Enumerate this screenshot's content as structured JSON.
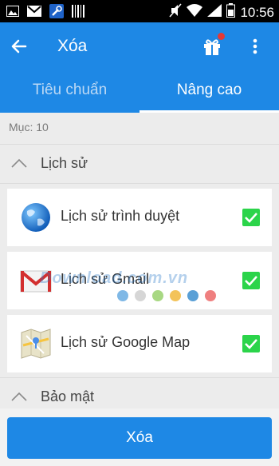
{
  "status_bar": {
    "time": "10:56",
    "icons": [
      "image-icon",
      "gmail-icon",
      "wrench-icon",
      "barcode-icon",
      "mute-icon",
      "wifi-icon",
      "signal-icon",
      "battery-icon"
    ]
  },
  "app_bar": {
    "title": "Xóa",
    "icons": [
      "back-arrow-icon",
      "gift-icon",
      "more-vert-icon"
    ],
    "accent_color": "#1e88e5",
    "badge_color": "#e53935"
  },
  "tabs": [
    {
      "label": "Tiêu chuẩn",
      "active": false
    },
    {
      "label": "Nâng cao",
      "active": true
    }
  ],
  "item_count": "Mục: 10",
  "sections": [
    {
      "title": "Lịch sử",
      "expanded": true,
      "items": [
        {
          "label": "Lịch sử trình duyệt",
          "icon": "globe-icon",
          "checked": true
        },
        {
          "label": "Lịch sử Gmail",
          "icon": "gmail-icon",
          "checked": true
        },
        {
          "label": "Lịch sử Google Map",
          "icon": "maps-icon",
          "checked": true
        }
      ]
    },
    {
      "title": "Bảo mật",
      "expanded": true,
      "items": []
    }
  ],
  "watermark": {
    "text": "Download.com.vn",
    "dot_colors": [
      "#7fb8e6",
      "#d6d6d6",
      "#a8d883",
      "#f3c35a",
      "#5aa0d6",
      "#ef7f7f"
    ]
  },
  "delete_button": {
    "label": "Xóa"
  },
  "check_color": "#2bd44a"
}
